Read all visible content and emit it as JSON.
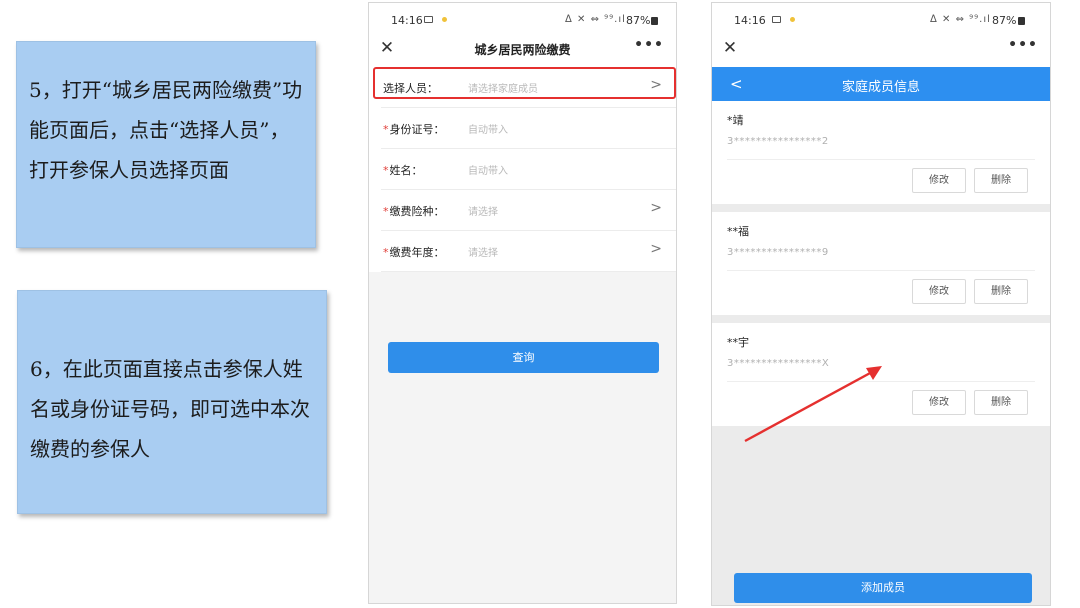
{
  "notes": {
    "step5": "5，打开“城乡居民两险缴费”功能页面后，点击“选择人员”，打开参保人员选择页面",
    "step6": "6，在此页面直接点击参保人姓名或身份证号码，即可选中本次缴费的参保人"
  },
  "status_bar": {
    "time": "14:16",
    "signal": "ᐃ ✕ ⇔ ⁹⁹.ıl",
    "battery": "87%"
  },
  "phone1": {
    "title": "城乡居民两险缴费",
    "close_icon": "close-icon",
    "more_label": "•••",
    "rows": [
      {
        "label": "选择人员：",
        "required": false,
        "value": "请选择家庭成员",
        "chevron": true
      },
      {
        "label": "身份证号：",
        "required": true,
        "value": "自动带入",
        "chevron": false
      },
      {
        "label": "姓名：",
        "required": true,
        "value": "自动带入",
        "chevron": false
      },
      {
        "label": "缴费险种：",
        "required": true,
        "value": "请选择",
        "chevron": true
      },
      {
        "label": "缴费年度：",
        "required": true,
        "value": "请选择",
        "chevron": true
      }
    ],
    "required_mark": "*",
    "chevron_glyph": ">",
    "query_button": "查询"
  },
  "phone2": {
    "title": "家庭成员信息",
    "back_glyph": "<",
    "more_label": "•••",
    "members": [
      {
        "name": "*靖",
        "id": "3****************2"
      },
      {
        "name": "**福",
        "id": "3****************9"
      },
      {
        "name": "**宇",
        "id": "3****************X"
      }
    ],
    "edit_label": "修改",
    "delete_label": "删除",
    "add_button": "添加成员"
  },
  "colors": {
    "accent_blue": "#2f8eea",
    "highlight_red": "#e5302f",
    "note_bg": "#a9cdf2"
  }
}
